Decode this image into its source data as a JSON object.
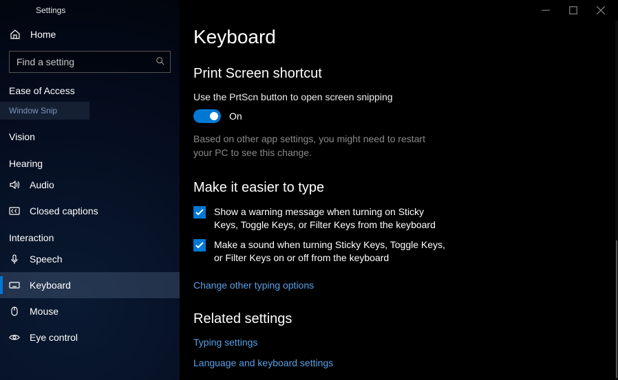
{
  "app_title": "Settings",
  "home_label": "Home",
  "search": {
    "placeholder": "Find a setting"
  },
  "section_label": "Ease of Access",
  "window_snip": "Window Snip",
  "sidebar": {
    "vision_header": "Vision",
    "hearing_header": "Hearing",
    "interaction_header": "Interaction",
    "vision_items": [
      {
        "label": "Vision"
      }
    ],
    "hearing_items": [
      {
        "label": "Audio"
      },
      {
        "label": "Closed captions"
      }
    ],
    "interaction_items": [
      {
        "label": "Speech"
      },
      {
        "label": "Keyboard"
      },
      {
        "label": "Mouse"
      },
      {
        "label": "Eye control"
      }
    ]
  },
  "page": {
    "title": "Keyboard",
    "sections": {
      "printscreen": {
        "title": "Print Screen shortcut",
        "desc": "Use the PrtScn button to open screen snipping",
        "toggle_state": "On",
        "note": "Based on other app settings, you might need to restart your PC to see this change."
      },
      "easier": {
        "title": "Make it easier to type",
        "check1": "Show a warning message when turning on Sticky Keys, Toggle Keys, or Filter Keys from the keyboard",
        "check2": "Make a sound when turning Sticky Keys, Toggle Keys, or Filter Keys on or off from the keyboard",
        "link": "Change other typing options"
      },
      "related": {
        "title": "Related settings",
        "link1": "Typing settings",
        "link2": "Language and keyboard settings"
      }
    }
  }
}
